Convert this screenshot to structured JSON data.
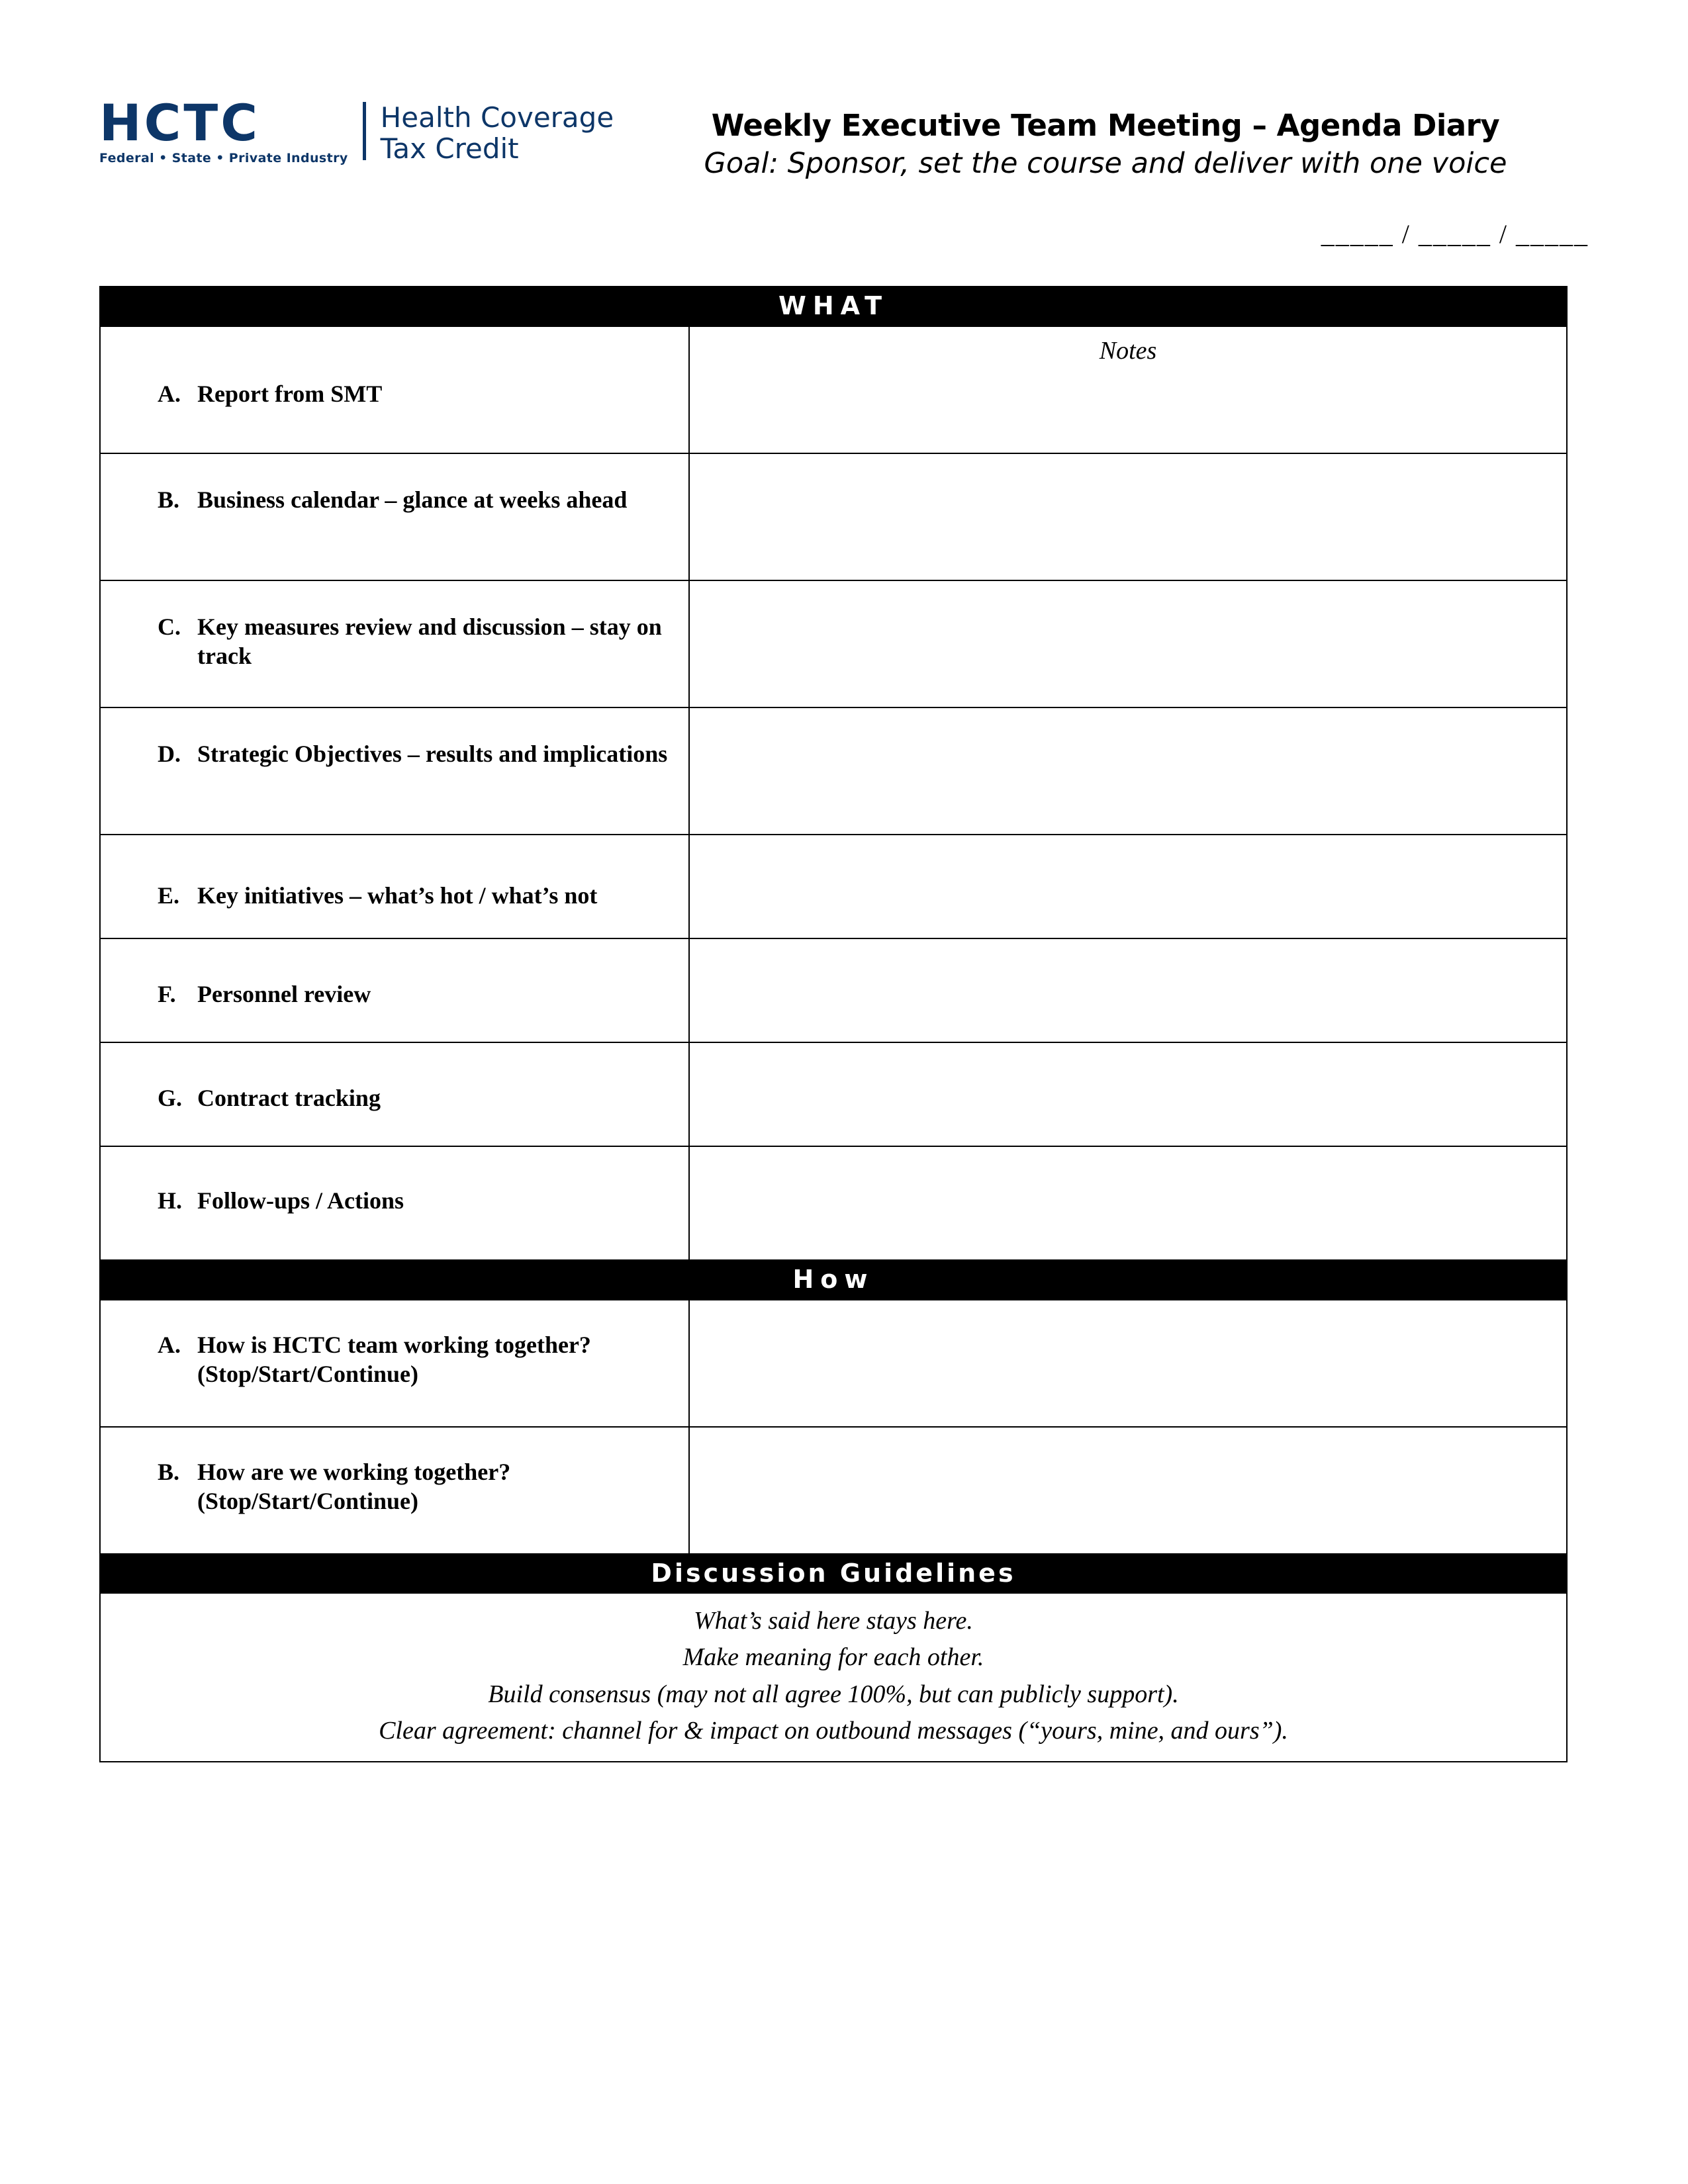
{
  "header": {
    "logo": {
      "acronym": "HCTC",
      "tagline": "Federal  •  State  •  Private Industry",
      "name_line1": "Health Coverage",
      "name_line2": "Tax Credit",
      "color": "#0d3668"
    },
    "title": "Weekly Executive Team Meeting – Agenda Diary",
    "subtitle": "Goal: Sponsor, set the course and deliver with one voice",
    "date_line": "_____ / _____ / _____"
  },
  "table": {
    "what_band": "WHAT",
    "notes_header": "Notes",
    "how_band": "How",
    "guidelines_band": "Discussion Guidelines",
    "what_items": [
      {
        "letter": "A.",
        "label": "Report from SMT"
      },
      {
        "letter": "B.",
        "label": "Business calendar – glance at weeks ahead"
      },
      {
        "letter": "C.",
        "label": "Key measures review and discussion – stay on track"
      },
      {
        "letter": "D.",
        "label": "Strategic Objectives – results and implications"
      },
      {
        "letter": "E.",
        "label": "Key initiatives – what’s hot / what’s not"
      },
      {
        "letter": "F.",
        "label": "Personnel review"
      },
      {
        "letter": "G.",
        "label": "Contract tracking"
      },
      {
        "letter": "H.",
        "label": "Follow-ups / Actions"
      }
    ],
    "how_items": [
      {
        "letter": "A.",
        "label": "How is HCTC team working together? (Stop/Start/Continue)"
      },
      {
        "letter": "B.",
        "label": "How are we working together? (Stop/Start/Continue)"
      }
    ],
    "guidelines": [
      "What’s said here stays here.",
      "Make meaning for each other.",
      "Build consensus (may not all agree 100%, but can publicly support).",
      "Clear agreement: channel for & impact on outbound messages (“yours, mine, and ours”)."
    ]
  }
}
